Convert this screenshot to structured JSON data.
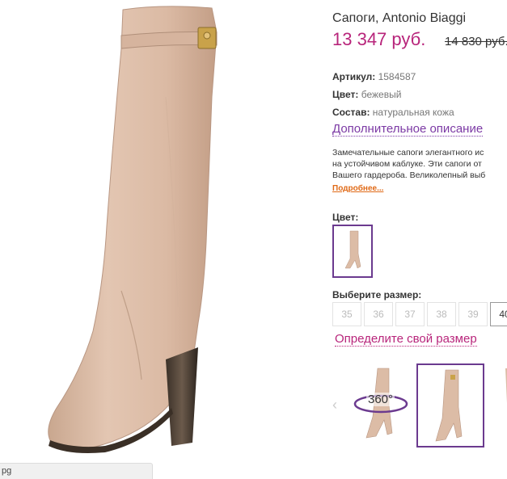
{
  "product": {
    "title": "Сапоги, Antonio Biaggi",
    "price": "13 347 руб.",
    "old_price": "14 830 руб."
  },
  "attributes": [
    {
      "label": "Артикул:",
      "value": "1584587"
    },
    {
      "label": "Цвет:",
      "value": "бежевый"
    },
    {
      "label": "Состав:",
      "value": "натуральная кожа"
    }
  ],
  "description": {
    "link": "Дополнительное описание",
    "lines": [
      "Замечательные сапоги элегантного ис",
      "на устойчивом каблуке. Эти сапоги от",
      "Вашего гардероба. Великолепный выб"
    ],
    "more": "Подробнее..."
  },
  "color_section": {
    "label": "Цвет:"
  },
  "size_section": {
    "label": "Выберите размер:",
    "sizes": [
      "35",
      "36",
      "37",
      "38",
      "39",
      "40"
    ],
    "size_link": "Определите свой размер"
  },
  "gallery": {
    "badge_360": "360°"
  },
  "browser": {
    "url_fragment": "pg"
  },
  "colors": {
    "accent": "#b8257b",
    "purple": "#6b3a8f",
    "link_orange": "#e06a17",
    "boot": "#dcbca6"
  }
}
